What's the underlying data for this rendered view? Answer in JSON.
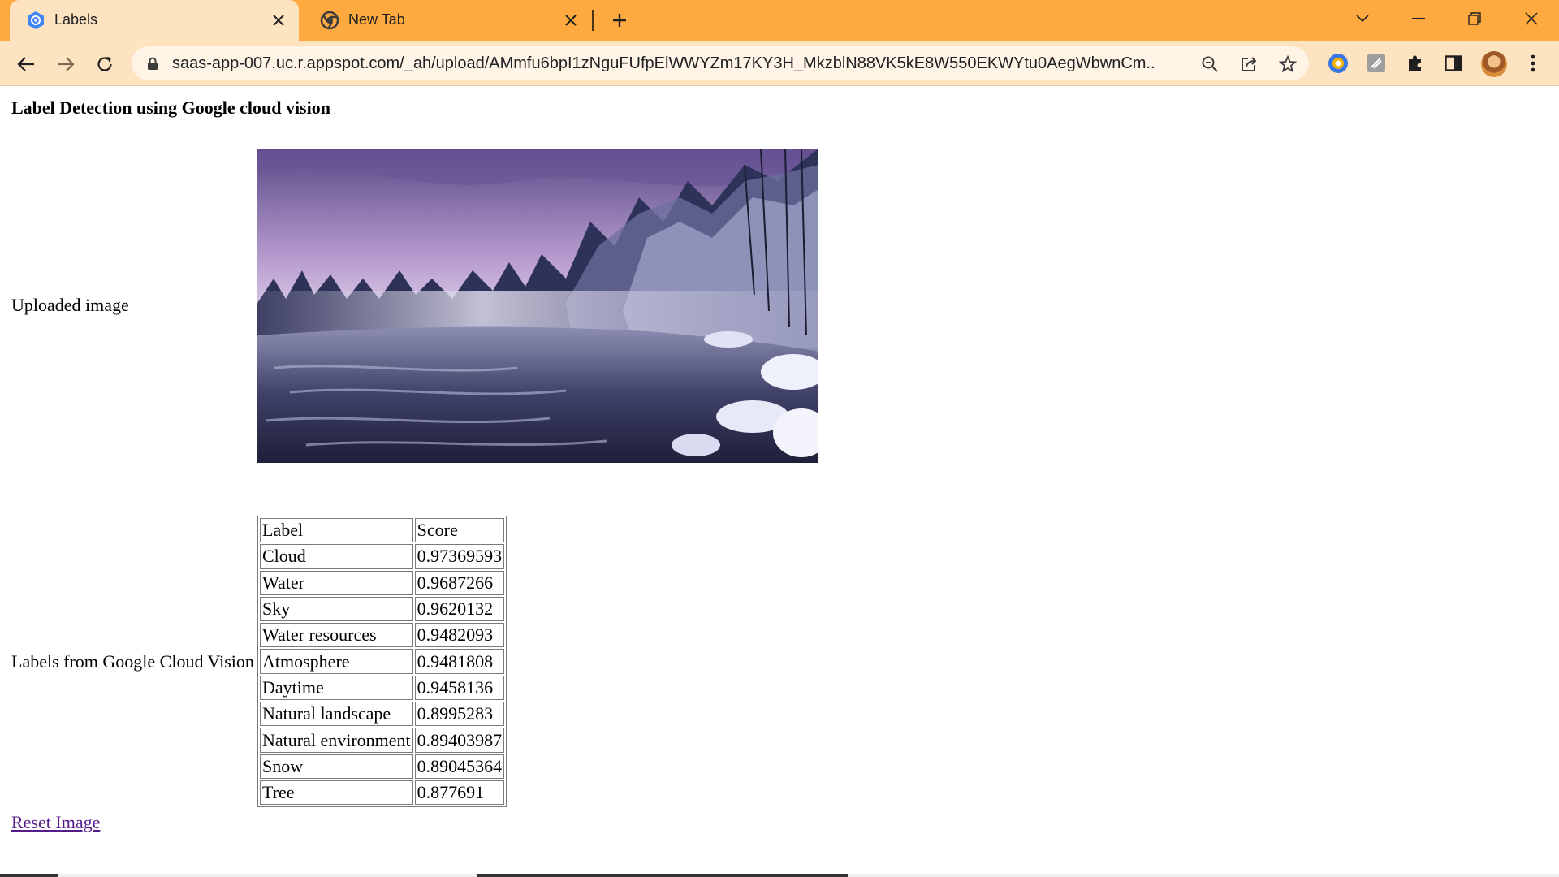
{
  "browser": {
    "tabs": [
      {
        "title": "Labels",
        "active": true
      },
      {
        "title": "New Tab",
        "active": false
      }
    ],
    "url": "saas-app-007.uc.r.appspot.com/_ah/upload/AMmfu6bpI1zNguFUfpElWWYZm17KY3H_MkzblN88VK5kE8W550EKWYtu0AegWbwnCm...",
    "accent_color": "#ffaa40",
    "toolbar_color": "#fde3c0"
  },
  "page": {
    "title": "Label Detection using Google cloud vision",
    "uploaded_image_label": "Uploaded image",
    "labels_section_label": "Labels from Google Cloud Vision",
    "table": {
      "headers": [
        "Label",
        "Score"
      ],
      "rows": [
        [
          "Cloud",
          "0.97369593"
        ],
        [
          "Water",
          "0.9687266"
        ],
        [
          "Sky",
          "0.9620132"
        ],
        [
          "Water resources",
          "0.9482093"
        ],
        [
          "Atmosphere",
          "0.9481808"
        ],
        [
          "Daytime",
          "0.9458136"
        ],
        [
          "Natural landscape",
          "0.8995283"
        ],
        [
          "Natural environment",
          "0.89403987"
        ],
        [
          "Snow",
          "0.89045364"
        ],
        [
          "Tree",
          "0.877691"
        ]
      ]
    },
    "reset_link": "Reset Image",
    "link_color": "#551a8b"
  }
}
